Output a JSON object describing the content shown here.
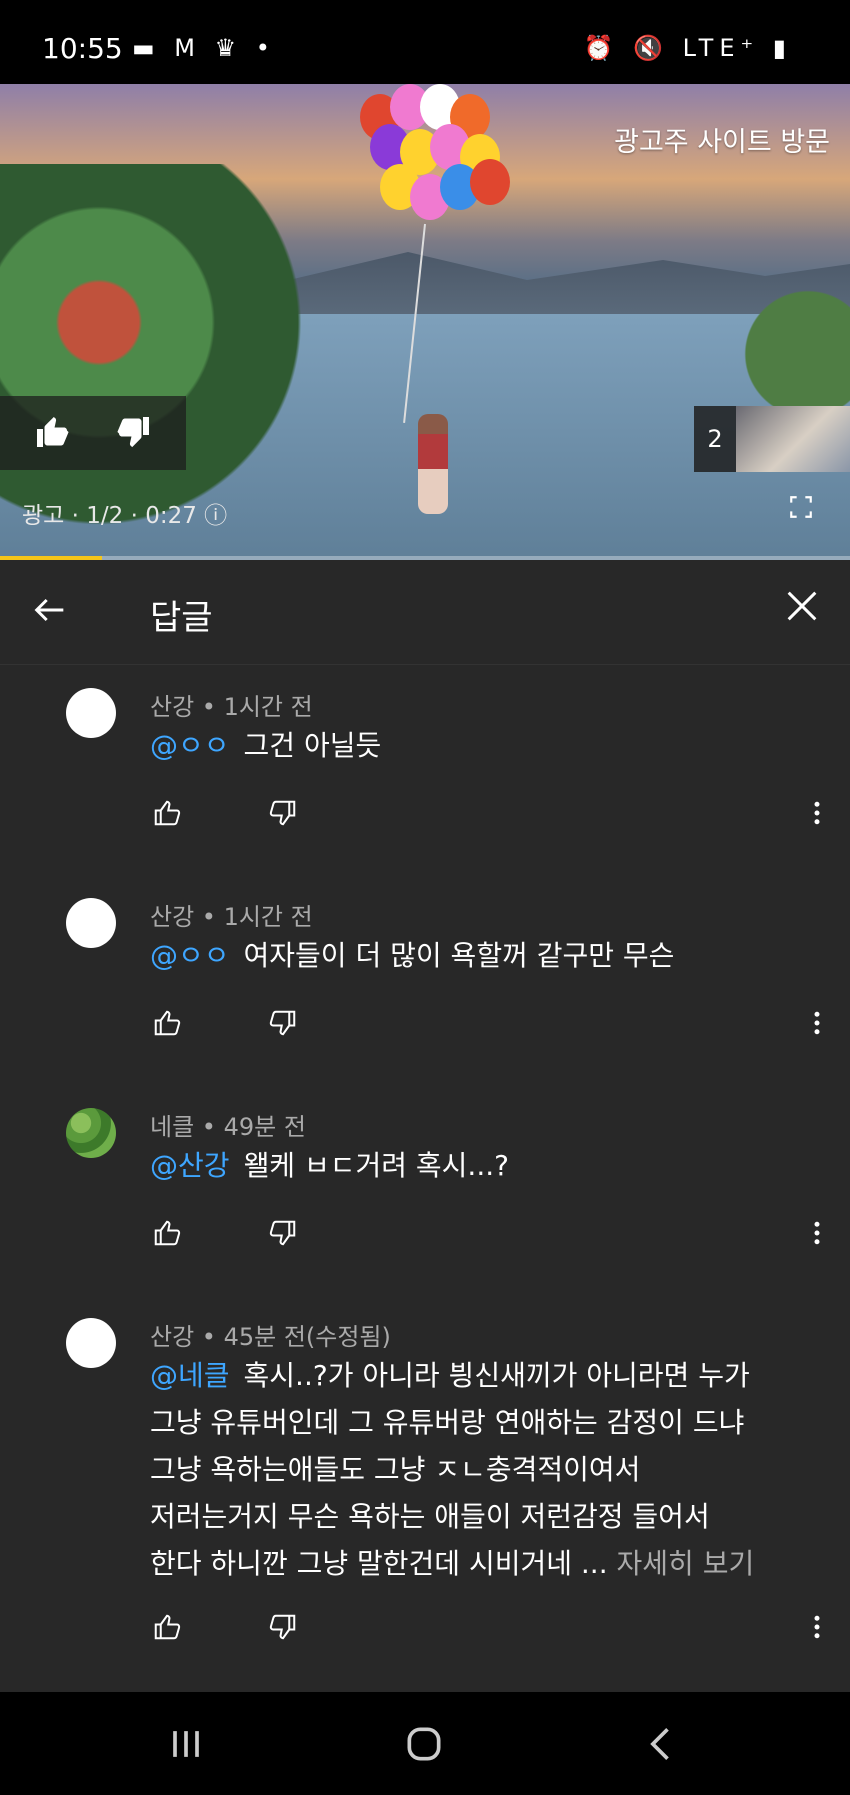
{
  "status_bar": {
    "time": "10:55",
    "left_icons": [
      "chat-icon",
      "gmail-icon",
      "crown-icon",
      "dot"
    ],
    "right_icons": [
      "alarm-icon",
      "mute-icon",
      "lte-icon",
      "signal-icon",
      "battery-icon"
    ],
    "left_glyphs": "▬ M ♛ •",
    "right_glyphs": "⏰ 🔇 LTE⁺ ▮"
  },
  "ad": {
    "visit_label": "광고주 사이트 방문",
    "info": "광고 · 1/2 · 0:27 ⓘ",
    "skip_count": "2",
    "progress": 0.12
  },
  "header": {
    "title": "답글"
  },
  "comments": [
    {
      "author": "산강",
      "time": "1시간 전",
      "meta": "산강 • 1시간 전",
      "mention": "@ㅇㅇ",
      "lines": [
        "그건 아닐듯"
      ]
    },
    {
      "author": "산강",
      "time": "1시간 전",
      "meta": "산강 • 1시간 전",
      "mention": "@ㅇㅇ",
      "lines": [
        "여자들이 더 많이 욕할꺼 같구만 무슨"
      ]
    },
    {
      "author": "네클",
      "time": "49분 전",
      "meta": "네클 • 49분 전",
      "mention": "@산강",
      "lines": [
        "왤케 ㅂㄷ거려 혹시...?"
      ]
    },
    {
      "author": "산강",
      "time": "45분 전(수정됨)",
      "meta": "산강 • 45분 전(수정됨)",
      "mention": "@네클",
      "lines": [
        "혹시..?가 아니라 븽신새끼가 아니라면 누가",
        "그냥 유튜버인데 그 유튜버랑 연애하는 감정이 드냐",
        "그냥 욕하는애들도 그냥 ㅈㄴ충격적이여서",
        "저러는거지 무슨 욕하는 애들이 저런감정 들어서",
        "한다 하니깐 그냥 말한건데 시비거네 ..."
      ],
      "more_label": "자세히 보기"
    }
  ],
  "colors": {
    "background": "#282828",
    "mention": "#3ea6ff",
    "meta": "#aaaaaa",
    "ad_progress": "#f5c518"
  }
}
